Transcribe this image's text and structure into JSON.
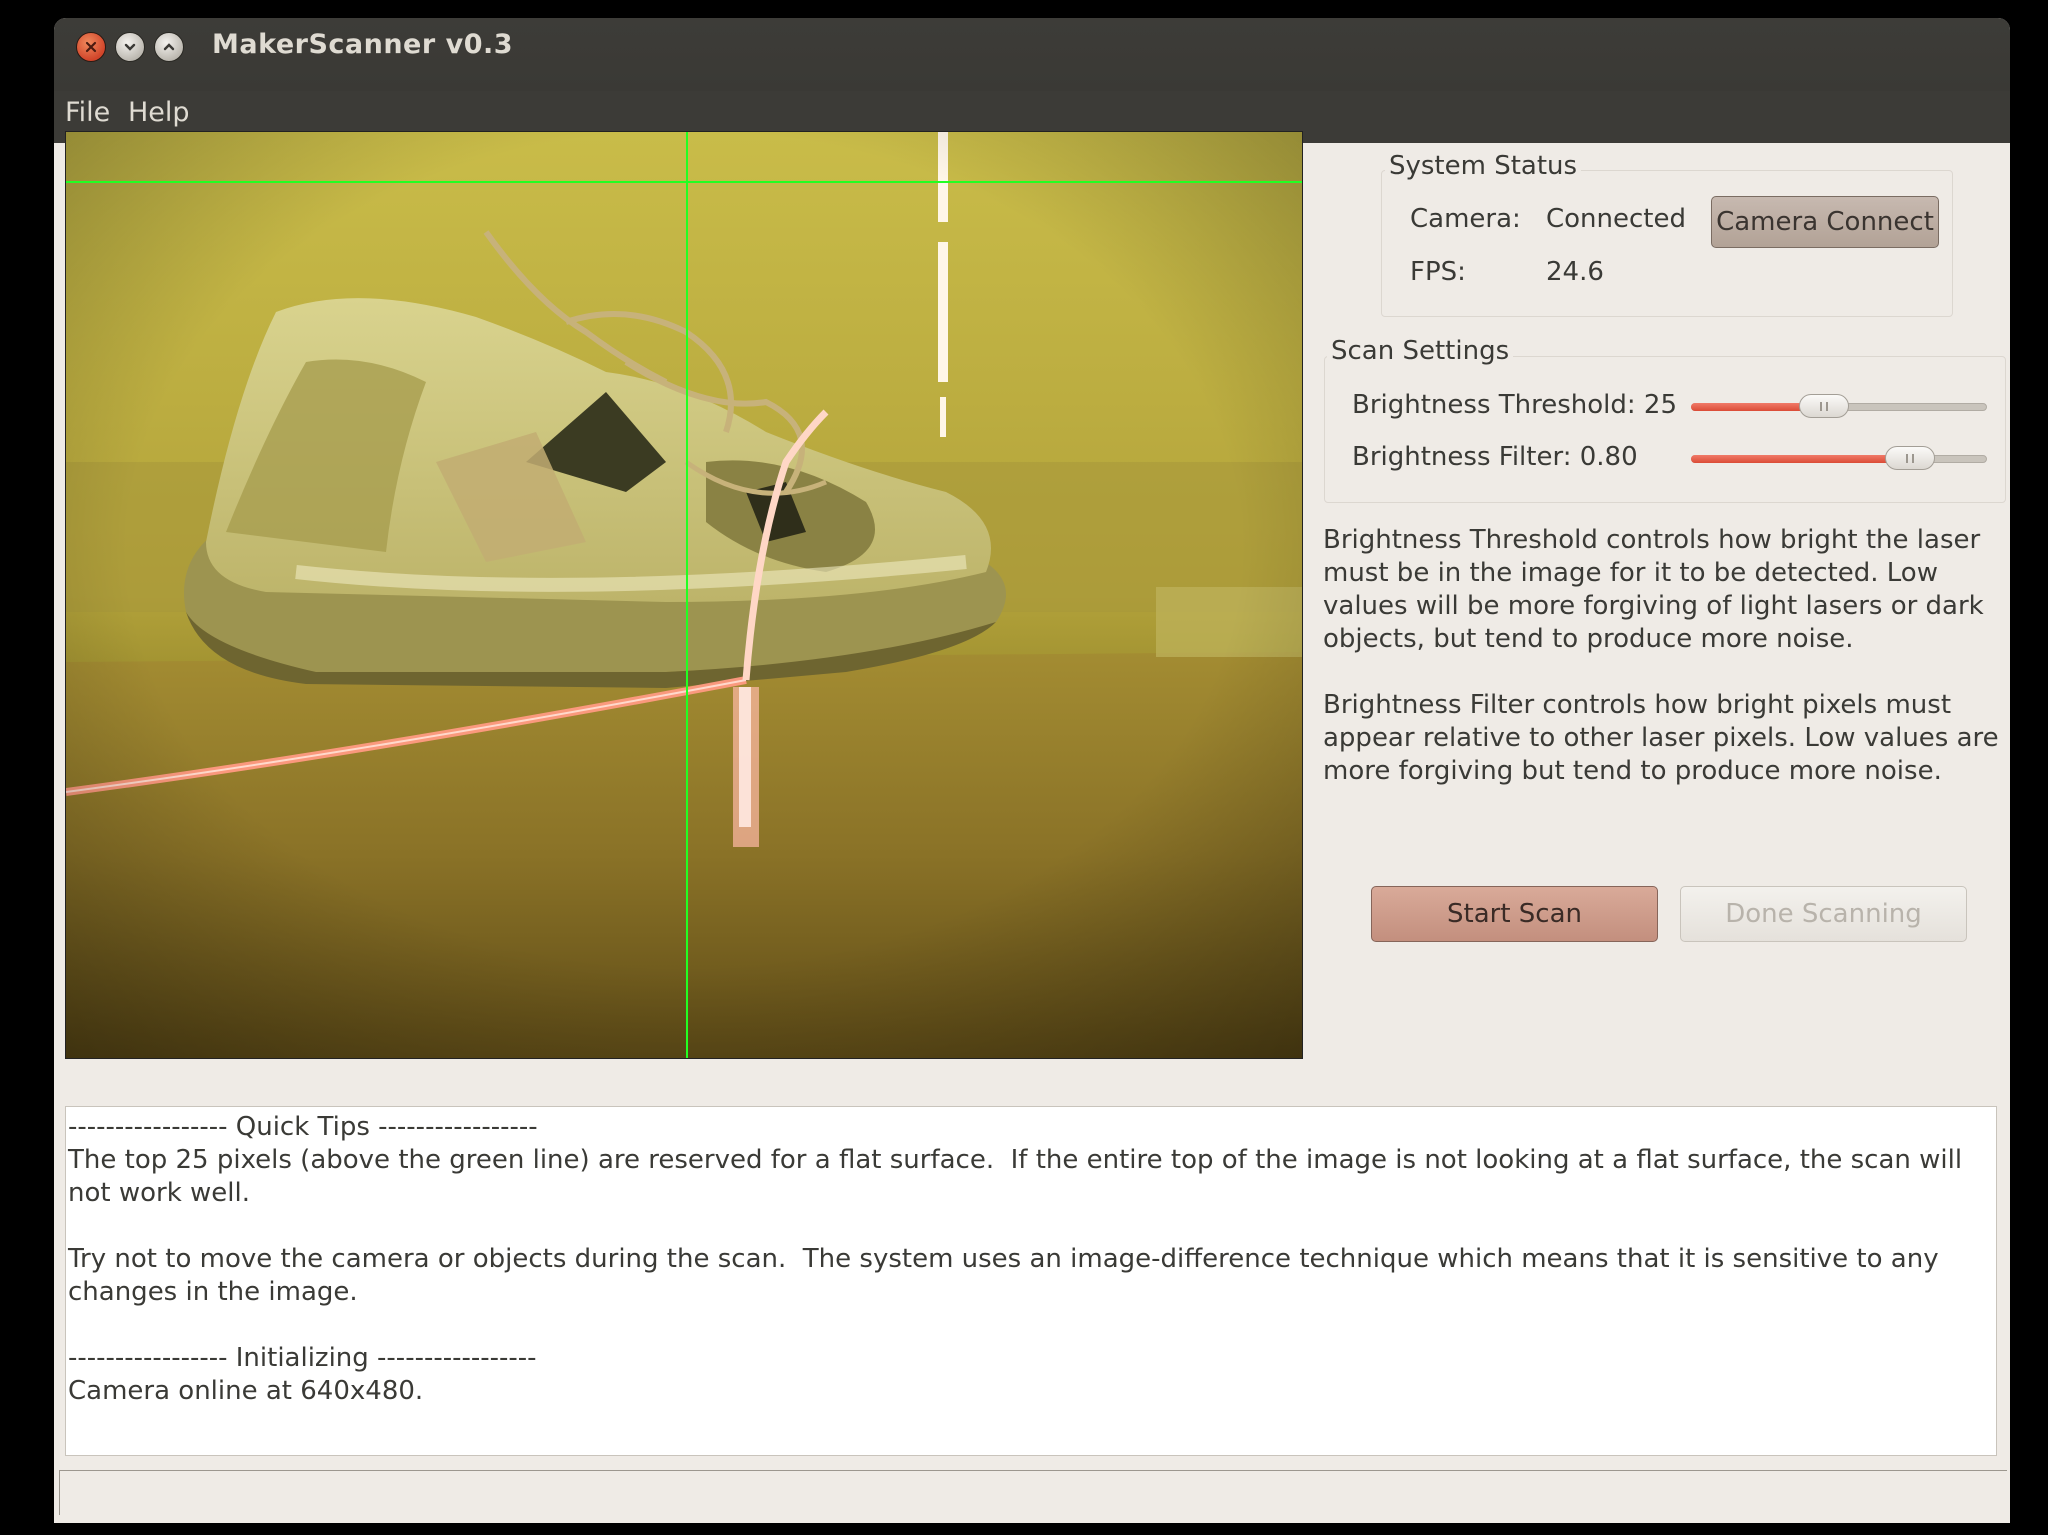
{
  "window": {
    "title": "MakerScanner v0.3"
  },
  "menubar": {
    "items": [
      "File",
      "Help"
    ]
  },
  "system_status": {
    "group_label": "System Status",
    "camera_label": "Camera:",
    "camera_value": "Connected",
    "camera_connect_button": "Camera Connect",
    "fps_label": "FPS:",
    "fps_value": "24.6"
  },
  "scan_settings": {
    "group_label": "Scan Settings",
    "brightness_threshold": {
      "label": "Brightness Threshold: 25",
      "level": 0.45
    },
    "brightness_filter": {
      "label": "Brightness Filter: 0.80",
      "level": 0.74
    }
  },
  "help": {
    "threshold_text": "Brightness Threshold controls how bright the laser must be in the image for it to be detected.  Low values will be more forgiving of light lasers or dark objects, but tend to produce more noise.",
    "filter_text": "Brightness Filter controls how bright pixels must appear relative to other laser pixels.  Low values are more forgiving but tend to produce more noise."
  },
  "actions": {
    "start_scan": "Start Scan",
    "done_scanning": "Done Scanning"
  },
  "log": {
    "lines": [
      "----------------- Quick Tips -----------------",
      "The top 25 pixels (above the green line) are reserved for a flat surface.  If the entire top of the image is not looking at a flat surface, the scan will not work well.",
      "",
      "Try not to move the camera or objects during the scan.  The system uses an image-difference technique which means that it is sensitive to any changes in the image.",
      "",
      "----------------- Initializing -----------------",
      "Camera online at 640x480."
    ]
  },
  "status_bar": {
    "text": ""
  },
  "colors": {
    "accent": "#db4b36",
    "guide_line": "#22ff22",
    "laser": "#ff8a70"
  }
}
